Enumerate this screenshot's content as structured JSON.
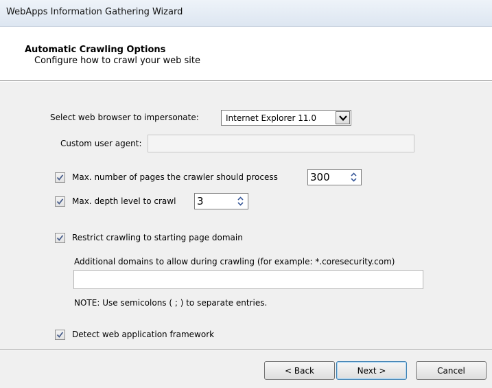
{
  "window": {
    "title": "WebApps Information Gathering Wizard"
  },
  "header": {
    "title": "Automatic Crawling Options",
    "subtitle": "Configure how to crawl your web site"
  },
  "browser": {
    "label": "Select web browser to impersonate:",
    "selected": "Internet Explorer 11.0"
  },
  "user_agent": {
    "label": "Custom user agent:",
    "value": ""
  },
  "max_pages": {
    "checked": true,
    "label": "Max. number of pages the crawler should process",
    "value": "300"
  },
  "max_depth": {
    "checked": true,
    "label": "Max. depth level to crawl",
    "value": "3"
  },
  "restrict": {
    "checked": true,
    "label": "Restrict crawling to starting page domain"
  },
  "additional_domains": {
    "label": "Additional domains to allow during crawling (for example: *.coresecurity.com)",
    "value": "",
    "note": "NOTE: Use semicolons ( ; ) to separate entries."
  },
  "detect_framework": {
    "checked": true,
    "label": "Detect web application framework"
  },
  "buttons": {
    "back": "< Back",
    "next": "Next >",
    "cancel": "Cancel"
  }
}
